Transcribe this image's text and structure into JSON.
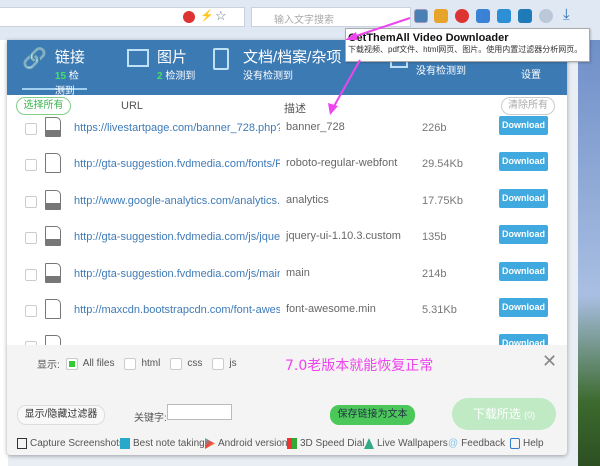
{
  "browser": {
    "search_placeholder": "输入文字搜索"
  },
  "tooltip": {
    "title": "GetThemAll Video Downloader",
    "text": "下载视频、pdf文件、html网页、图片。使用内置过滤器分析网页。"
  },
  "tabs": [
    {
      "label": "链接",
      "count": "15",
      "suffix": "检测到"
    },
    {
      "label": "图片",
      "count": "2",
      "suffix": "检测到"
    },
    {
      "label": "文档/档案/杂项",
      "status": "没有检测到"
    },
    {
      "label": "",
      "status": "没有检测到"
    }
  ],
  "settings_label": "设置",
  "columns": {
    "select_all": "选择所有",
    "url": "URL",
    "desc": "描述",
    "clear_all": "清除所有"
  },
  "rows": [
    {
      "url": "https://livestartpage.com/banner_728.php?...",
      "desc": "banner_728",
      "size": "226b",
      "type": "html"
    },
    {
      "url": "http://gta-suggestion.fvdmedia.com/fonts/R...",
      "desc": "roboto-regular-webfont",
      "size": "29.54Kb",
      "type": "file"
    },
    {
      "url": "http://www.google-analytics.com/analytics.js",
      "desc": "analytics",
      "size": "17.75Kb",
      "type": "js"
    },
    {
      "url": "http://gta-suggestion.fvdmedia.com/js/jquer...",
      "desc": "jquery-ui-1.10.3.custom",
      "size": "135b",
      "type": "js"
    },
    {
      "url": "http://gta-suggestion.fvdmedia.com/js/main.js",
      "desc": "main",
      "size": "214b",
      "type": "js"
    },
    {
      "url": "http://maxcdn.bootstrapcdn.com/font-aweso...",
      "desc": "font-awesome.min",
      "size": "5.31Kb",
      "type": "file"
    }
  ],
  "download_label": "Download",
  "filter": {
    "show_label": "显示:",
    "options": [
      "All files",
      "html",
      "css",
      "js"
    ],
    "checked": "All files"
  },
  "annotation": "7.0老版本就能恢复正常",
  "footer": {
    "toggle_filter": "显示/隐藏过滤器",
    "keyword_label": "关键字:",
    "keyword_value": "",
    "save_links": "保存链接为文本",
    "download_selected": "下载所选",
    "selected_count": "(0)"
  },
  "links": [
    "Capture Screenshots",
    "Best note taking",
    "Android version",
    "3D Speed Dial",
    "Live Wallpapers",
    "Feedback",
    "Help"
  ],
  "colors": {
    "header": "#3c7ab4",
    "accent_green": "#4cc759",
    "download": "#3fa9e0",
    "annotation": "#ee44ee"
  }
}
